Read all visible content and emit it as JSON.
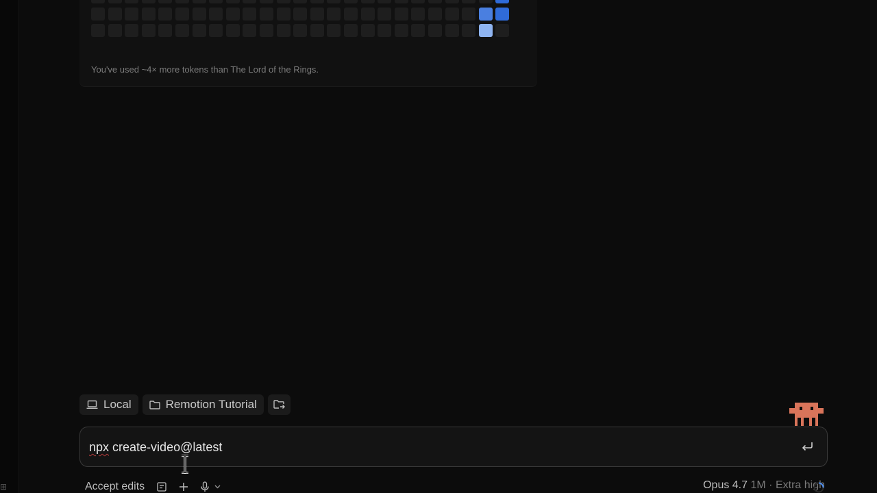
{
  "stats": {
    "caption": "You've used ~4× more tokens than The Lord of the Rings.",
    "heatmap": {
      "columns": 25,
      "rows": 3,
      "empty_color": "#1e1e1e",
      "levels": {
        "1": "#8fb4f0",
        "2": "#4a7fe0",
        "3": "#2f6bd9"
      },
      "active_cells": [
        {
          "col": 24,
          "row": 0,
          "level": 3
        },
        {
          "col": 23,
          "row": 1,
          "level": 2
        },
        {
          "col": 24,
          "row": 1,
          "level": 3
        },
        {
          "col": 23,
          "row": 2,
          "level": 1
        }
      ]
    }
  },
  "chips": {
    "environment": {
      "label": "Local",
      "icon": "laptop-icon"
    },
    "project": {
      "label": "Remotion Tutorial",
      "icon": "folder-icon"
    },
    "switch_project": {
      "icon": "folder-switch-icon"
    }
  },
  "prompt": {
    "text_misspelled": "npx",
    "text_rest": " create-video@latest",
    "submit_icon": "enter-icon"
  },
  "toolbar": {
    "mode_label": "Accept edits",
    "mode_icon": "plan-icon",
    "add_icon": "plus-icon",
    "mic_icon": "mic-icon",
    "mic_menu_icon": "chevron-down-icon"
  },
  "model": {
    "name": "Opus 4.7",
    "context": "1M",
    "separator": "·",
    "effort": "Extra high"
  },
  "colors": {
    "accent": "#2f6bd9",
    "mascot": "#d9745a"
  }
}
